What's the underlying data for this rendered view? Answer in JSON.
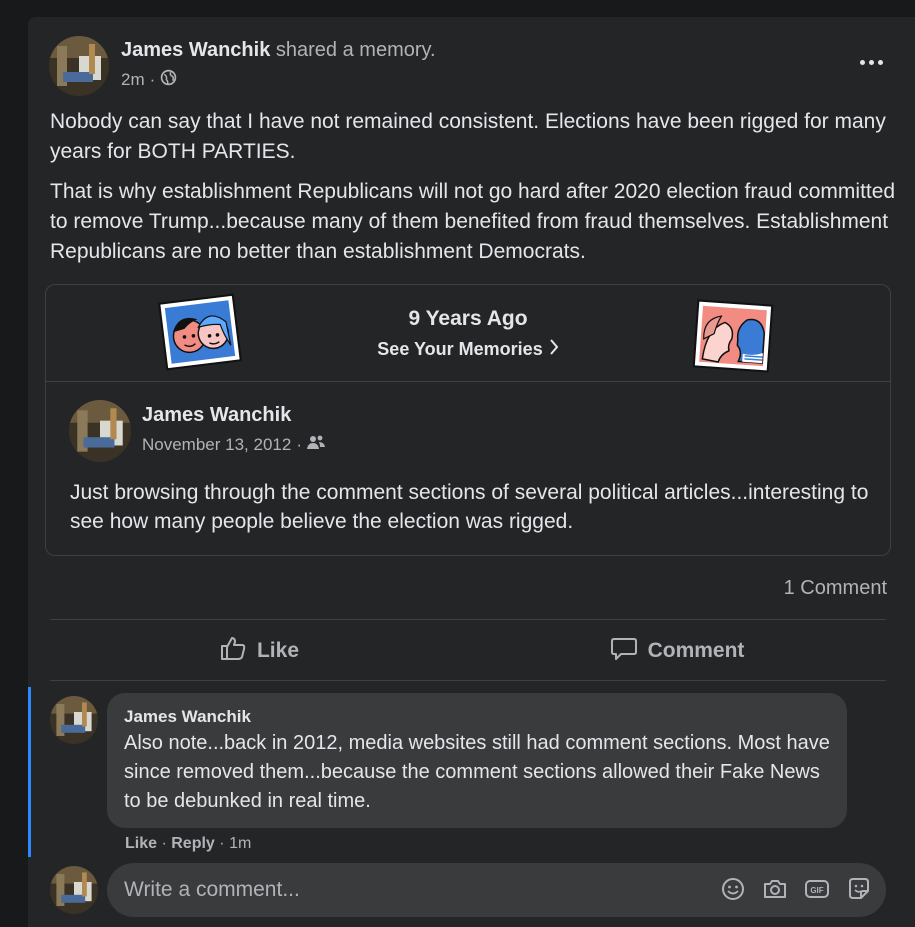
{
  "post": {
    "author": "James Wanchik",
    "action": "shared a memory.",
    "time": "2m",
    "time_separator": "·",
    "paragraphs": [
      "Nobody can say that I have not remained consistent. Elections have been rigged for many years for BOTH PARTIES.",
      "That is why establishment Republicans will not go hard after 2020 election fraud committed to remove Trump...because many of them benefited from fraud themselves. Establishment Republicans are no better than establishment Democrats."
    ]
  },
  "memory": {
    "title": "9 Years Ago",
    "link_label": "See Your Memories",
    "shared_post": {
      "author": "James Wanchik",
      "date": "November 13, 2012",
      "separator": "·",
      "text": "Just browsing through the comment sections of several political articles...interesting to see how many people believe the election was rigged."
    }
  },
  "stats": {
    "comment_count": "1 Comment"
  },
  "actions": {
    "like_label": "Like",
    "comment_label": "Comment"
  },
  "comment": {
    "author": "James Wanchik",
    "text": "Also note...back in 2012, media websites still had comment sections. Most have since removed them...because the comment sections allowed their Fake News to be debunked in real time.",
    "like_label": "Like",
    "reply_label": "Reply",
    "separator": "·",
    "time": "1m"
  },
  "composer": {
    "placeholder": "Write a comment..."
  },
  "colors": {
    "background": "#18191a",
    "card": "#242526",
    "bubble": "#3a3b3c",
    "text_primary": "#e4e6eb",
    "text_secondary": "#b0b3b8",
    "divider": "#3e4042",
    "accent": "#2d88ff"
  },
  "icons": {
    "privacy": "globe-icon",
    "audience": "friends-icon",
    "more": "more-dots-icon",
    "like": "thumbs-up-icon",
    "comment": "speech-bubble-icon",
    "emoji": "smiley-icon",
    "photo": "camera-icon",
    "gif": "gif-icon",
    "sticker": "sticker-icon"
  }
}
